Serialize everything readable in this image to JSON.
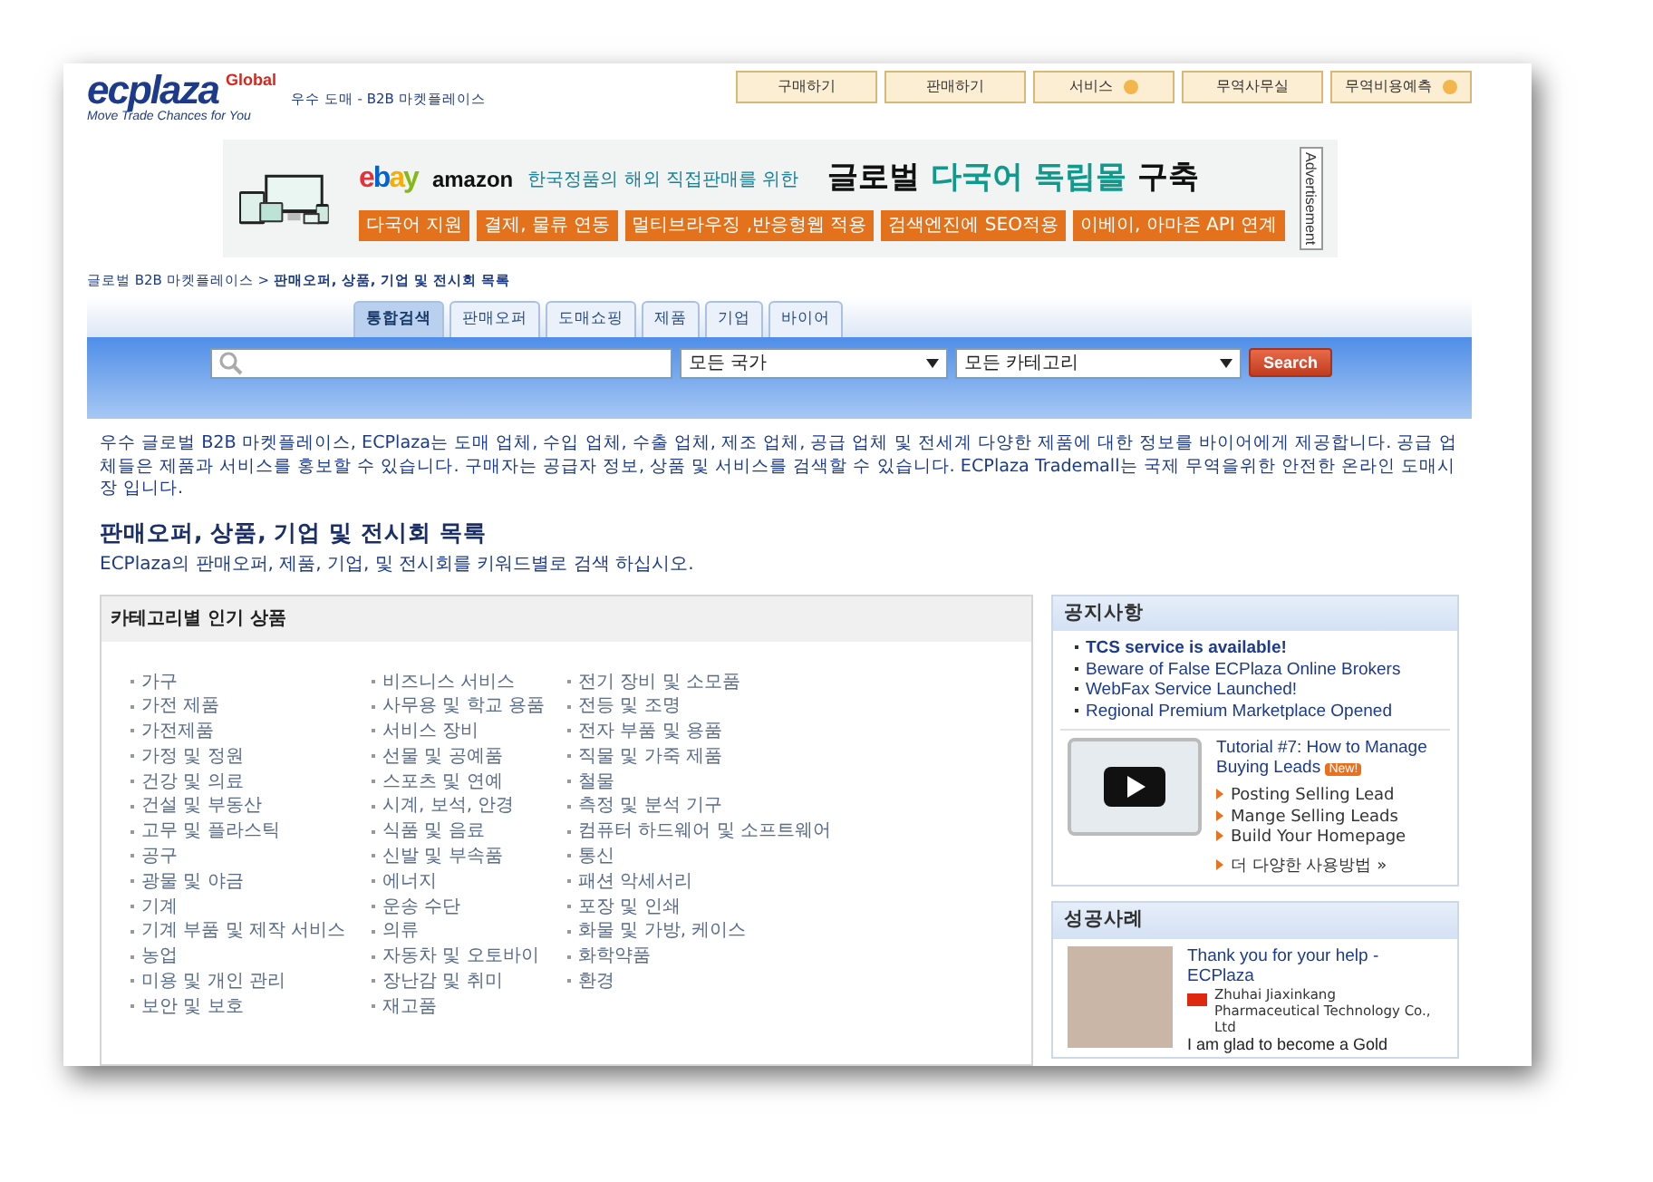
{
  "header": {
    "logo": {
      "wordmark": "ecplaza",
      "badge": "Global",
      "slogan": "Move Trade Chances for You"
    },
    "tagline": "우수 도매 - B2B 마켓플레이스",
    "nav": [
      {
        "label": "구매하기",
        "dropdown": false
      },
      {
        "label": "판매하기",
        "dropdown": false
      },
      {
        "label": "서비스",
        "dropdown": true
      },
      {
        "label": "무역사무실",
        "dropdown": false
      },
      {
        "label": "무역비용예측",
        "dropdown": true
      }
    ]
  },
  "banner": {
    "brands": [
      "ebay",
      "amazon"
    ],
    "lead": "한국정품의 해외 직접판매를 위한",
    "headline": [
      {
        "text": "글로벌",
        "accent": false
      },
      {
        "text": "다국어 독립몰",
        "accent": true
      },
      {
        "text": "구축",
        "accent": false
      }
    ],
    "tags": [
      "다국어 지원",
      "결제, 물류 연동",
      "멀티브라우징 ,반응형웹 적용",
      "검색엔진에 SEO적용",
      "이베이, 아마존 API 연계"
    ],
    "ad_label": "Advertisement"
  },
  "breadcrumb": {
    "home": "글로벌 B2B 마켓플레이스",
    "separator": ">",
    "current": "판매오퍼, 상품, 기업 및 전시회 목록"
  },
  "search": {
    "tabs": [
      {
        "label": "통합검색",
        "selected": true
      },
      {
        "label": "판매오퍼",
        "selected": false
      },
      {
        "label": "도매쇼핑",
        "selected": false
      },
      {
        "label": "제품",
        "selected": false
      },
      {
        "label": "기업",
        "selected": false
      },
      {
        "label": "바이어",
        "selected": false
      }
    ],
    "country": "모든 국가",
    "category": "모든 카테고리",
    "button": "Search"
  },
  "intro": "우수 글로벌 B2B 마켓플레이스, ECPlaza는 도매 업체, 수입 업체, 수출 업체, 제조 업체, 공급 업체 및 전세계 다양한 제품에 대한 정보를 바이어에게 제공합니다. 공급 업체들은 제품과 서비스를 홍보할 수 있습니다. 구매자는 공급자 정보, 상품 및 서비스를 검색할 수 있습니다. ECPlaza Trademall는 국제 무역을위한 안전한 온라인 도매시장 입니다.",
  "section": {
    "title": "판매오퍼, 상품, 기업 및 전시회 목록",
    "subtitle": "ECPlaza의 판매오퍼, 제품, 기업, 및 전시회를 키워드별로 검색 하십시오."
  },
  "categories": {
    "title": "카테고리별 인기 상품",
    "columns": [
      [
        "가구",
        "가전 제품",
        "가전제품",
        "가정 및 정원",
        "건강 및 의료",
        "건설 및 부동산",
        "고무 및 플라스틱",
        "공구",
        "광물 및 야금",
        "기계",
        "기계 부품 및 제작 서비스",
        "농업",
        "미용 및 개인 관리",
        "보안 및 보호"
      ],
      [
        "비즈니스 서비스",
        "사무용 및 학교 용품",
        "서비스 장비",
        "선물 및 공예품",
        "스포츠 및 연예",
        "시계, 보석, 안경",
        "식품 및 음료",
        "신발 및 부속품",
        "에너지",
        "운송 수단",
        "의류",
        "자동차 및 오토바이",
        "장난감 및 취미",
        "재고품"
      ],
      [
        "전기 장비 및 소모품",
        "전등 및 조명",
        "전자 부품 및 용품",
        "직물 및 가죽 제품",
        "철물",
        "측정 및 분석 기구",
        "컴퓨터 하드웨어 및 소프트웨어",
        "통신",
        "패션 악세서리",
        "포장 및 인쇄",
        "화물 및 가방, 케이스",
        "화학약품",
        "환경"
      ]
    ]
  },
  "notices": {
    "title": "공지사항",
    "items": [
      {
        "text": "TCS service is available!",
        "bold": true
      },
      {
        "text": "Beware of False ECPlaza Online Brokers",
        "bold": false
      },
      {
        "text": "WebFax Service Launched!",
        "bold": false
      },
      {
        "text": "Regional Premium Marketplace Opened",
        "bold": false
      }
    ],
    "tutorial": {
      "title": "Tutorial #7: How to Manage Buying Leads",
      "badge": "New!",
      "links": [
        "Posting Selling Lead",
        "Mange Selling Leads",
        "Build Your Homepage"
      ],
      "more": "더 다양한 사용방법 »"
    }
  },
  "success": {
    "title": "성공사례",
    "story": {
      "title": "Thank you for your help - ECPlaza",
      "company": "Zhuhai Jiaxinkang Pharmaceutical Technology Co., Ltd",
      "quote": "I am glad to become a Gold"
    }
  }
}
